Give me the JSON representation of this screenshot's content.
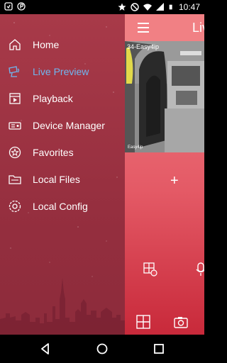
{
  "status_bar": {
    "time": "10:47",
    "left_icons": [
      "notification-icon",
      "p-icon"
    ],
    "right_icons": [
      "star-icon",
      "mute-icon",
      "wifi-icon",
      "signal-icon",
      "battery-icon"
    ]
  },
  "drawer": {
    "items": [
      {
        "label": "Home",
        "icon": "home-icon",
        "active": false
      },
      {
        "label": "Live Preview",
        "icon": "live-preview-icon",
        "active": true
      },
      {
        "label": "Playback",
        "icon": "playback-icon",
        "active": false
      },
      {
        "label": "Device Manager",
        "icon": "device-manager-icon",
        "active": false
      },
      {
        "label": "Favorites",
        "icon": "favorites-icon",
        "active": false
      },
      {
        "label": "Local Files",
        "icon": "local-files-icon",
        "active": false
      },
      {
        "label": "Local Config",
        "icon": "local-config-icon",
        "active": false
      }
    ]
  },
  "main": {
    "title": "Live Preview",
    "camera_name": "34-Easy4ip",
    "camera_brand": "Easy4ip",
    "add_label": "+",
    "controls": [
      "snapshot-grid-icon",
      "microphone-icon",
      "split-layout-icon",
      "camera-icon"
    ]
  },
  "nav_bar": [
    "back-icon",
    "home-circle-icon",
    "recent-apps-icon"
  ],
  "colors": {
    "drawer": "#9a3142",
    "accent_active": "#6fb7f0",
    "main_top": "#f18084",
    "main_bottom": "#c8293a"
  }
}
